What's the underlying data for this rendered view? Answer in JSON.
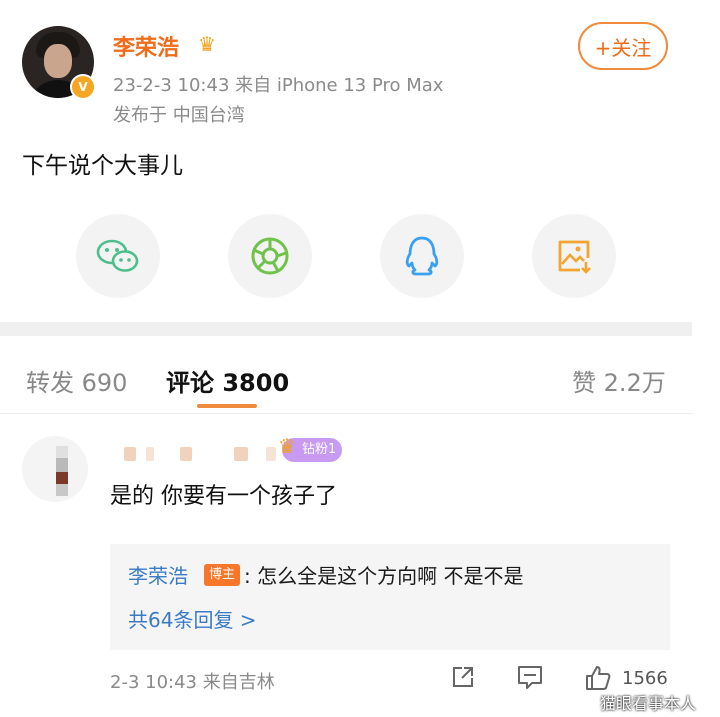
{
  "post": {
    "author": "李荣浩",
    "verified_badge": "V",
    "crown_icon": "crown-icon",
    "meta": "23-2-3 10:43  来自 iPhone 13 Pro Max",
    "location": "发布于 中国台湾",
    "follow_label": "+关注",
    "content": "下午说个大事儿",
    "share_icons": [
      "wechat-icon",
      "moments-icon",
      "qq-icon",
      "save-image-icon"
    ]
  },
  "tabs": {
    "repost": "转发 690",
    "comment": "评论 3800",
    "like": "赞 2.2万"
  },
  "comment": {
    "fan_badge": "钻粉1",
    "text": "是的 你要有一个孩子了",
    "reply": {
      "author": "李荣浩",
      "badge": "博主",
      "text": ": 怎么全是这个方向啊 不是不是",
      "more": "共64条回复 >"
    },
    "meta": "2-3 10:43  来自吉林",
    "likes": "1566"
  },
  "watermark": "猫眼看事本人",
  "colors": {
    "accent": "#ef6c1a",
    "link": "#3b7bc4",
    "muted": "#8a8a8a"
  }
}
